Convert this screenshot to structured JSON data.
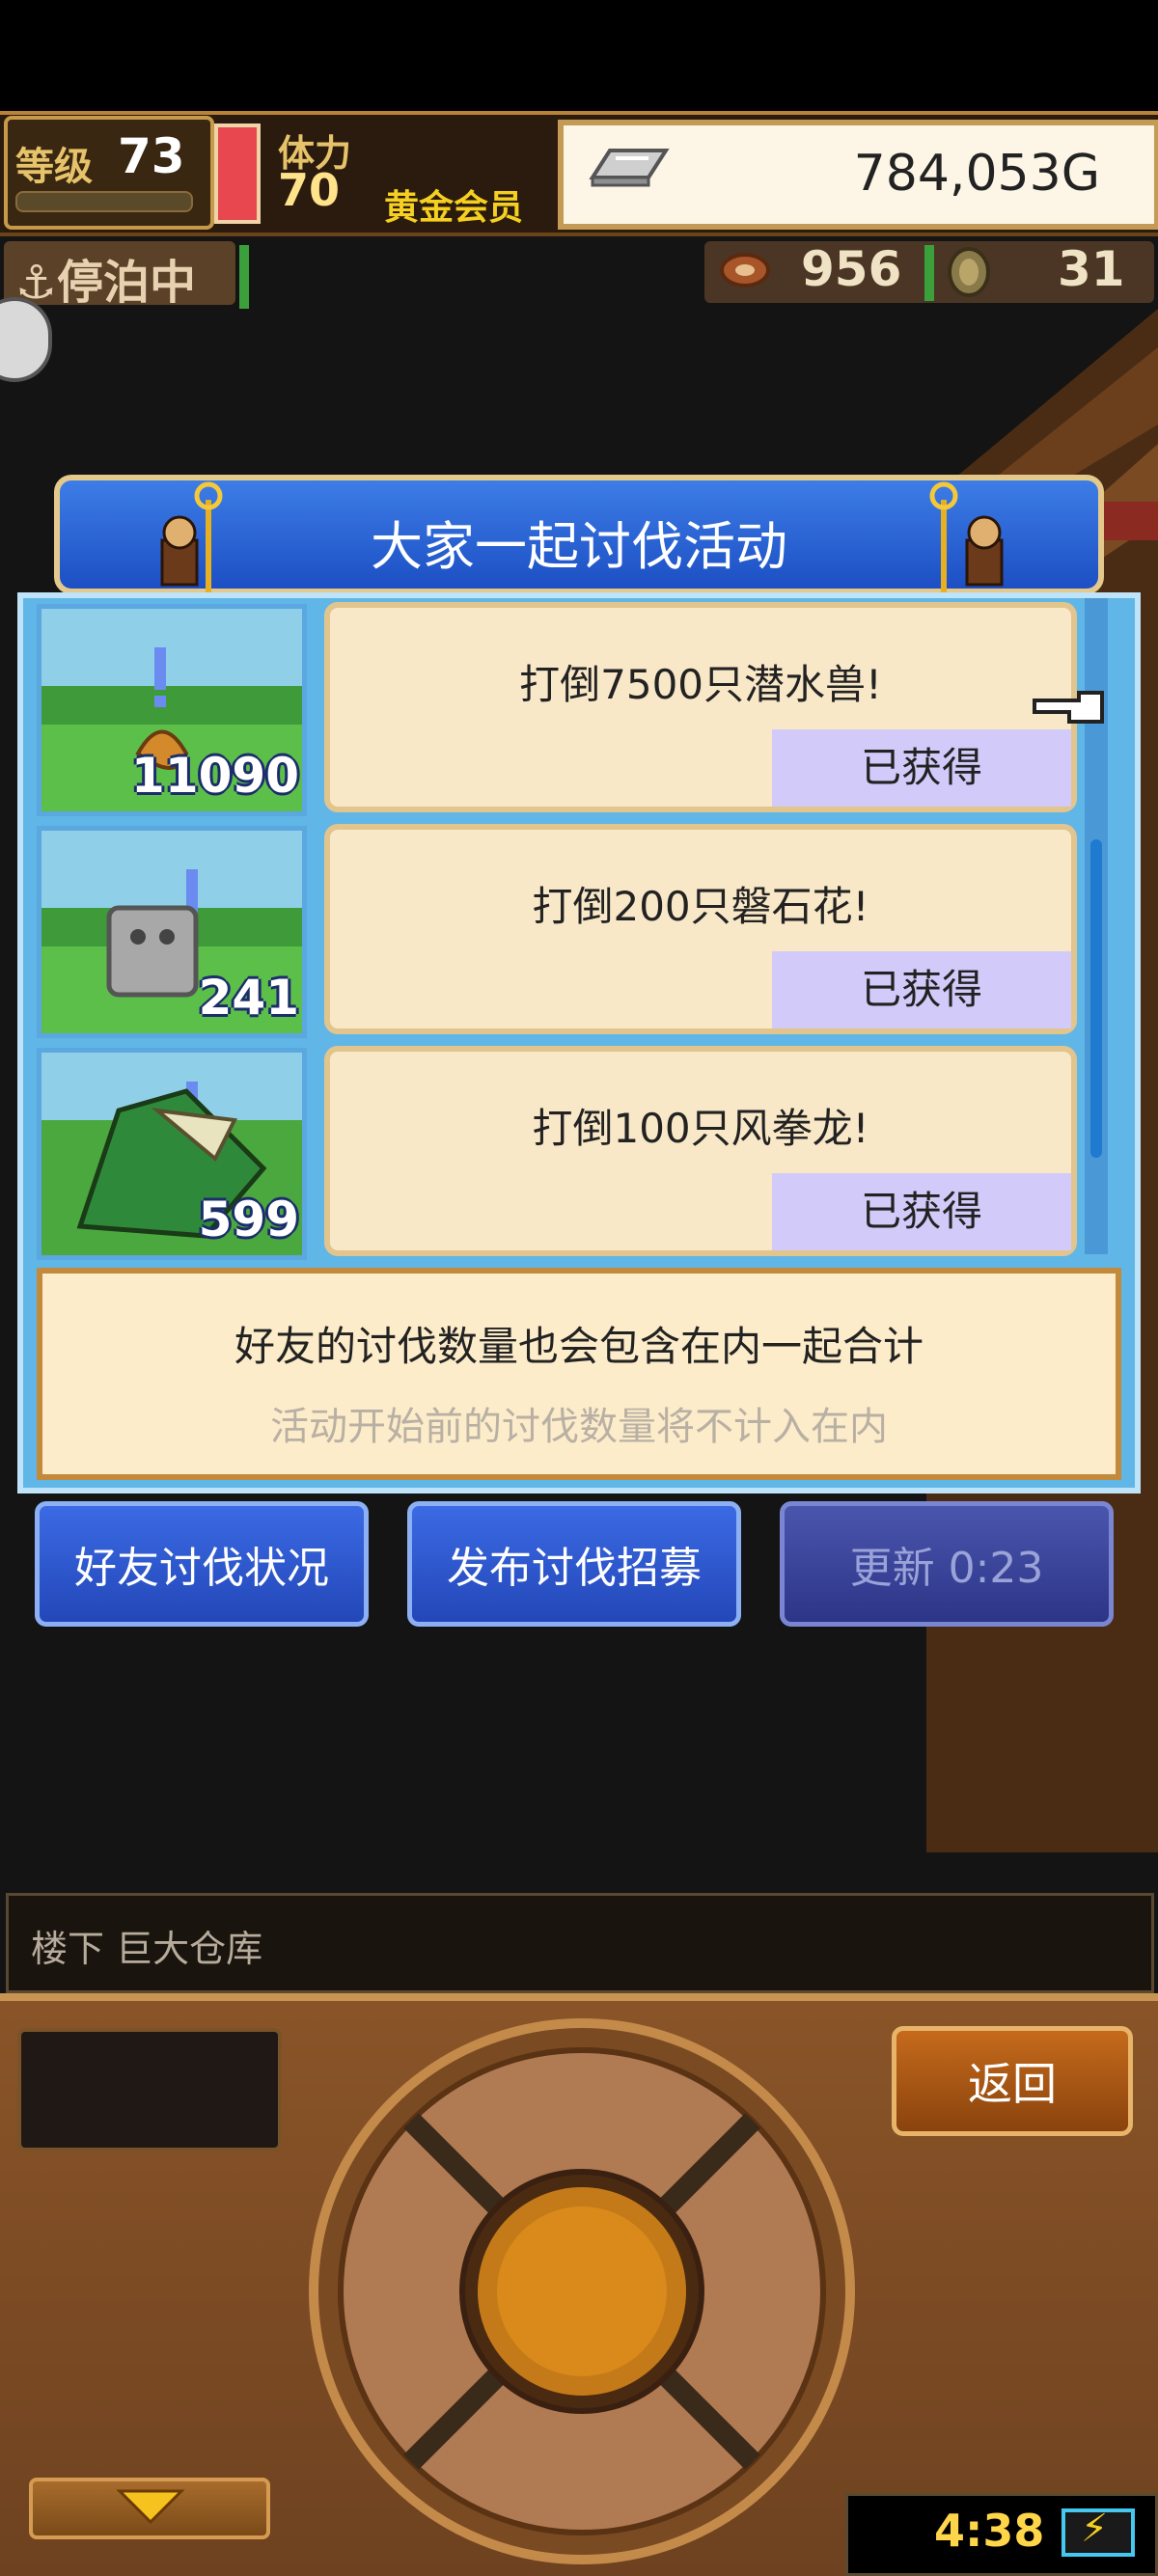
{
  "hud": {
    "level_label": "等级",
    "level_value": "73",
    "stamina_label": "体力",
    "stamina_value": "70",
    "member_label": "黄金会员",
    "gold": "784,053G",
    "gold_icon": "gold-bar-icon",
    "status_label": "停泊中",
    "status_icon": "anchor-icon",
    "resources": [
      {
        "icon": "meat-icon",
        "value": "956"
      },
      {
        "icon": "coin-icon",
        "value": "31"
      }
    ]
  },
  "dialog": {
    "title": "大家一起讨伐活动",
    "missions": [
      {
        "count": "11090",
        "text": "打倒7500只潜水兽!",
        "status": "已获得",
        "monster_icon": "water-beast-icon"
      },
      {
        "count": "241",
        "text": "打倒200只磐石花!",
        "status": "已获得",
        "monster_icon": "rock-flower-icon"
      },
      {
        "count": "599",
        "text": "打倒100只风拳龙!",
        "status": "已获得",
        "monster_icon": "wind-fist-dragon-icon"
      }
    ],
    "info_main": "好友的讨伐数量也会包含在内一起合计",
    "info_sub": "活动开始前的讨伐数量将不计入在内"
  },
  "actions": {
    "friend_status": "好友讨伐状况",
    "post_recruit": "发布讨伐招募",
    "refresh": "更新 0:23"
  },
  "footer": {
    "location": "楼下 巨大仓库",
    "back": "返回",
    "clock": "4:38"
  },
  "colors": {
    "dialog_blue": "#2a5ed6",
    "obtained_bg": "#d2cbfa",
    "mission_bg": "#f9e8c8",
    "panel_brown": "#7a4a22"
  }
}
